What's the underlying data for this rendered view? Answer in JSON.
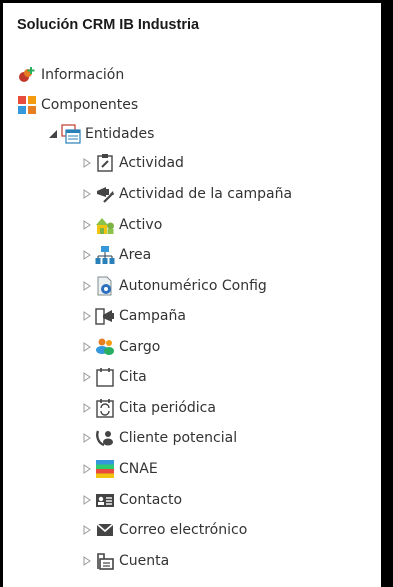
{
  "panel": {
    "title": "Solución CRM IB Industria",
    "info_label": "Información",
    "components_label": "Componentes",
    "entities_label": "Entidades"
  },
  "entities": [
    {
      "label": "Actividad",
      "icon": "activity-icon"
    },
    {
      "label": "Actividad de la campaña",
      "icon": "campaign-activity-icon"
    },
    {
      "label": "Activo",
      "icon": "asset-icon"
    },
    {
      "label": "Area",
      "icon": "area-icon"
    },
    {
      "label": "Autonumérico Config",
      "icon": "autonumber-config-icon"
    },
    {
      "label": "Campaña",
      "icon": "campaign-icon"
    },
    {
      "label": "Cargo",
      "icon": "position-icon"
    },
    {
      "label": "Cita",
      "icon": "appointment-icon"
    },
    {
      "label": "Cita periódica",
      "icon": "recurring-appointment-icon"
    },
    {
      "label": "Cliente potencial",
      "icon": "lead-icon"
    },
    {
      "label": "CNAE",
      "icon": "cnae-icon"
    },
    {
      "label": "Contacto",
      "icon": "contact-icon"
    },
    {
      "label": "Correo electrónico",
      "icon": "email-icon"
    },
    {
      "label": "Cuenta",
      "icon": "account-icon"
    }
  ]
}
